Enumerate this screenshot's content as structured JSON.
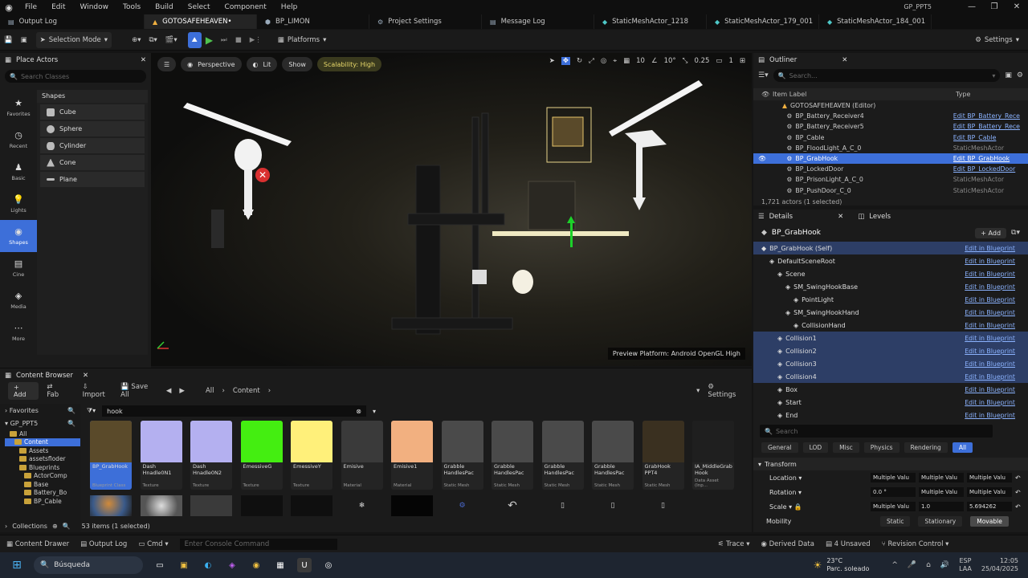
{
  "menu": {
    "items": [
      "File",
      "Edit",
      "Window",
      "Tools",
      "Build",
      "Select",
      "Component",
      "Help"
    ],
    "project": "GP_PPT5"
  },
  "tabs": [
    "Output Log",
    "GOTOSAFEHEAVEN•",
    "BP_LIMON",
    "Project Settings",
    "Message Log",
    "StaticMeshActor_1218",
    "StaticMeshActor_179_001",
    "StaticMeshActor_184_001"
  ],
  "toolbar": {
    "mode": "Selection Mode",
    "platforms": "Platforms",
    "settings": "Settings"
  },
  "place_actors": {
    "title": "Place Actors",
    "search_placeholder": "Search Classes",
    "shapes_header": "Shapes",
    "shapes": [
      "Cube",
      "Sphere",
      "Cylinder",
      "Cone",
      "Plane"
    ],
    "categories": [
      "Favorites",
      "Recent",
      "Basic",
      "Lights",
      "Shapes",
      "Cine",
      "Media",
      "More"
    ]
  },
  "viewport": {
    "perspective": "Perspective",
    "lit": "Lit",
    "show": "Show",
    "scalability": "Scalability: High",
    "grid": "10",
    "angle": "10°",
    "scale": "0.25",
    "cam": "1",
    "preview": "Preview Platform: Android OpenGL High"
  },
  "outliner": {
    "title": "Outliner",
    "search_placeholder": "Search...",
    "col_label": "Item Label",
    "col_type": "Type",
    "root": "GOTOSAFEHEAVEN (Editor)",
    "rows": [
      {
        "name": "BP_Battery_Receiver4",
        "type": "Edit BP_Battery_Rece",
        "link": true
      },
      {
        "name": "BP_Battery_Receiver5",
        "type": "Edit BP_Battery_Rece",
        "link": true
      },
      {
        "name": "BP_Cable",
        "type": "Edit BP_Cable",
        "link": true
      },
      {
        "name": "BP_FloodLight_A_C_0",
        "type": "StaticMeshActor",
        "link": false
      },
      {
        "name": "BP_GrabHook",
        "type": "Edit BP_GrabHook",
        "link": true
      },
      {
        "name": "BP_LockedDoor",
        "type": "Edit BP_LockedDoor",
        "link": true
      },
      {
        "name": "BP_PrisonLight_A_C_0",
        "type": "StaticMeshActor",
        "link": false
      },
      {
        "name": "BP_PushDoor_C_0",
        "type": "StaticMeshActor",
        "link": false
      }
    ],
    "status": "1,721 actors (1 selected)"
  },
  "details": {
    "title": "Details",
    "levels": "Levels",
    "object": "BP_GrabHook",
    "add": "Add",
    "self": "BP_GrabHook (Self)",
    "edit": "Edit in Blueprint",
    "components": [
      {
        "name": "DefaultSceneRoot",
        "indent": 1
      },
      {
        "name": "Scene",
        "indent": 2
      },
      {
        "name": "SM_SwingHookBase",
        "indent": 3
      },
      {
        "name": "PointLight",
        "indent": 4
      },
      {
        "name": "SM_SwingHookHand",
        "indent": 3
      },
      {
        "name": "CollisionHand",
        "indent": 4
      },
      {
        "name": "Collision1",
        "indent": 2
      },
      {
        "name": "Collision2",
        "indent": 2
      },
      {
        "name": "Collision3",
        "indent": 2
      },
      {
        "name": "Collision4",
        "indent": 2
      },
      {
        "name": "Box",
        "indent": 2
      },
      {
        "name": "Start",
        "indent": 2
      },
      {
        "name": "End",
        "indent": 2
      }
    ],
    "search_placeholder": "Search",
    "filters": [
      "General",
      "LOD",
      "Misc",
      "Physics",
      "Rendering",
      "All"
    ],
    "transform": "Transform",
    "location": "Location",
    "rotation": "Rotation",
    "scale": "Scale",
    "mobility": "Mobility",
    "loc_vals": [
      "Multiple Valu",
      "Multiple Valu",
      "Multiple Valu"
    ],
    "rot_vals": [
      "0.0 °",
      "Multiple Valu",
      "Multiple Valu"
    ],
    "scale_vals": [
      "Multiple Valu",
      "1.0",
      "5.694262"
    ],
    "mobility_opts": [
      "Static",
      "Stationary",
      "Movable"
    ]
  },
  "content_browser": {
    "title": "Content Browser",
    "add": "Add",
    "fab": "Fab",
    "import": "Import",
    "save_all": "Save All",
    "path_all": "All",
    "path_content": "Content",
    "settings": "Settings",
    "favorites": "Favorites",
    "project": "GP_PPT5",
    "search_value": "hook",
    "tree": [
      "All",
      "Content",
      "Assets",
      "assetsfloder",
      "Blueprints",
      "ActorComp",
      "Base",
      "Battery_Bo",
      "BP_Cable"
    ],
    "assets": [
      {
        "name": "BP_GrabHook",
        "type": "Blueprint Class",
        "color": "#5a4a2a"
      },
      {
        "name": "Dash Hnadle0N1",
        "type": "Texture",
        "color": "#b4b0f0"
      },
      {
        "name": "Dash Hnadle0N2",
        "type": "Texture",
        "color": "#b4b0f0"
      },
      {
        "name": "EmessiveG",
        "type": "Texture",
        "color": "#44ee11"
      },
      {
        "name": "EmessiveY",
        "type": "Texture",
        "color": "#fff07a"
      },
      {
        "name": "Emisive",
        "type": "Material",
        "color": "#3a3a3a"
      },
      {
        "name": "Emisive1",
        "type": "Material",
        "color": "#f2b080"
      },
      {
        "name": "Grabble HandlesPac",
        "type": "Static Mesh",
        "color": "#4a4a4a"
      },
      {
        "name": "Grabble HandlesPac",
        "type": "Static Mesh",
        "color": "#4a4a4a"
      },
      {
        "name": "Grabble HandlesPac",
        "type": "Static Mesh",
        "color": "#4a4a4a"
      },
      {
        "name": "Grabble HandlesPac",
        "type": "Static Mesh",
        "color": "#4a4a4a"
      },
      {
        "name": "GrabHook PPT4",
        "type": "Static Mesh",
        "color": "#3a3020"
      },
      {
        "name": "IA_MiddleGrab Hook",
        "type": "Data Asset (Inp...",
        "color": "#1f1f1f"
      }
    ],
    "status": "53 items (1 selected)",
    "collections": "Collections"
  },
  "statusbar": {
    "drawer": "Content Drawer",
    "output": "Output Log",
    "cmd": "Cmd",
    "console_placeholder": "Enter Console Command",
    "trace": "Trace",
    "derived": "Derived Data",
    "unsaved": "4 Unsaved",
    "revision": "Revision Control"
  },
  "taskbar": {
    "search": "Búsqueda",
    "temp": "23°C",
    "weather": "Parc. soleado",
    "lang": "ESP",
    "lang2": "LAA",
    "time": "12:05",
    "date": "25/04/2025"
  }
}
